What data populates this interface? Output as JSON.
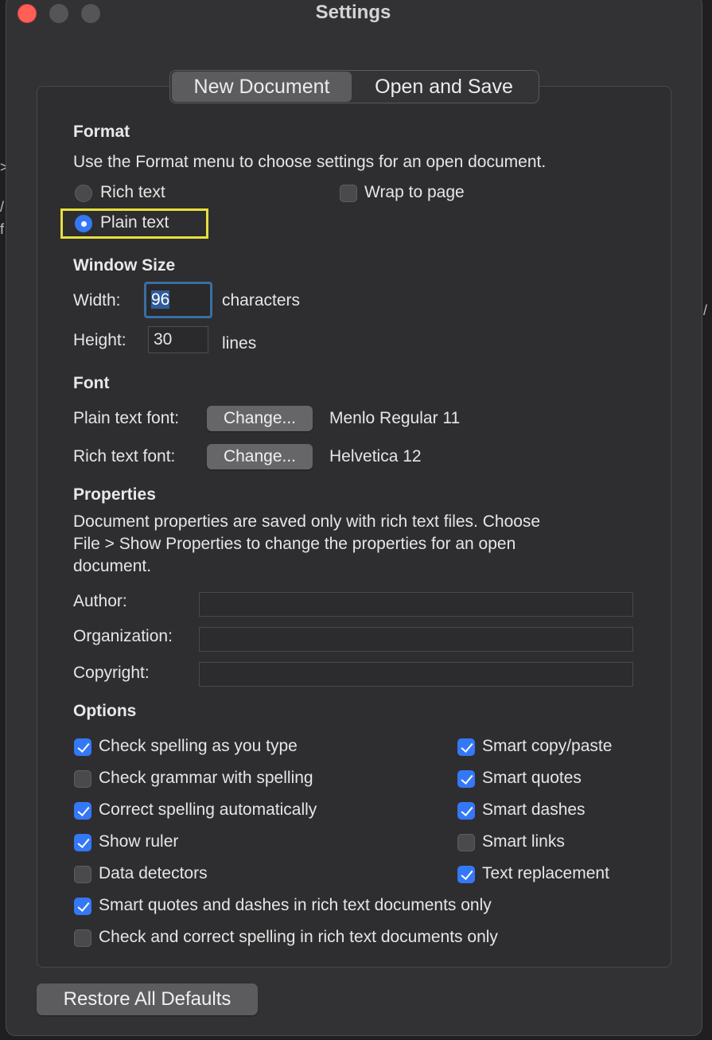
{
  "window": {
    "title": "Settings"
  },
  "tabs": [
    {
      "label": "New Document",
      "active": true
    },
    {
      "label": "Open and Save",
      "active": false
    }
  ],
  "format": {
    "heading": "Format",
    "description": "Use the Format menu to choose settings for an open document.",
    "rich_text_label": "Rich text",
    "plain_text_label": "Plain text",
    "selected": "Plain text",
    "wrap_to_page_label": "Wrap to page",
    "wrap_to_page_checked": false
  },
  "window_size": {
    "heading": "Window Size",
    "width_label": "Width:",
    "width_value": "96",
    "width_unit": "characters",
    "height_label": "Height:",
    "height_value": "30",
    "height_unit": "lines"
  },
  "font": {
    "heading": "Font",
    "plain_label": "Plain text font:",
    "plain_button": "Change...",
    "plain_value": "Menlo Regular 11",
    "rich_label": "Rich text font:",
    "rich_button": "Change...",
    "rich_value": "Helvetica 12"
  },
  "properties": {
    "heading": "Properties",
    "desc_line1": "Document properties are saved only with rich text files. Choose",
    "desc_line2": "File > Show Properties to change the properties for an open",
    "desc_line3": "document.",
    "author_label": "Author:",
    "author_value": "",
    "organization_label": "Organization:",
    "organization_value": "",
    "copyright_label": "Copyright:",
    "copyright_value": ""
  },
  "options": {
    "heading": "Options",
    "items": [
      {
        "label": "Check spelling as you type",
        "checked": true
      },
      {
        "label": "Check grammar with spelling",
        "checked": false
      },
      {
        "label": "Correct spelling automatically",
        "checked": true
      },
      {
        "label": "Show ruler",
        "checked": true
      },
      {
        "label": "Data detectors",
        "checked": false
      },
      {
        "label": "Smart copy/paste",
        "checked": true
      },
      {
        "label": "Smart quotes",
        "checked": true
      },
      {
        "label": "Smart dashes",
        "checked": true
      },
      {
        "label": "Smart links",
        "checked": false
      },
      {
        "label": "Text replacement",
        "checked": true
      },
      {
        "label": "Smart quotes and dashes in rich text documents only",
        "checked": true
      },
      {
        "label": "Check and correct spelling in rich text documents only",
        "checked": false
      }
    ]
  },
  "footer": {
    "restore_label": "Restore All Defaults"
  },
  "colors": {
    "accent": "#3478f6",
    "highlight": "#e6df3e",
    "window_bg": "#323234"
  }
}
